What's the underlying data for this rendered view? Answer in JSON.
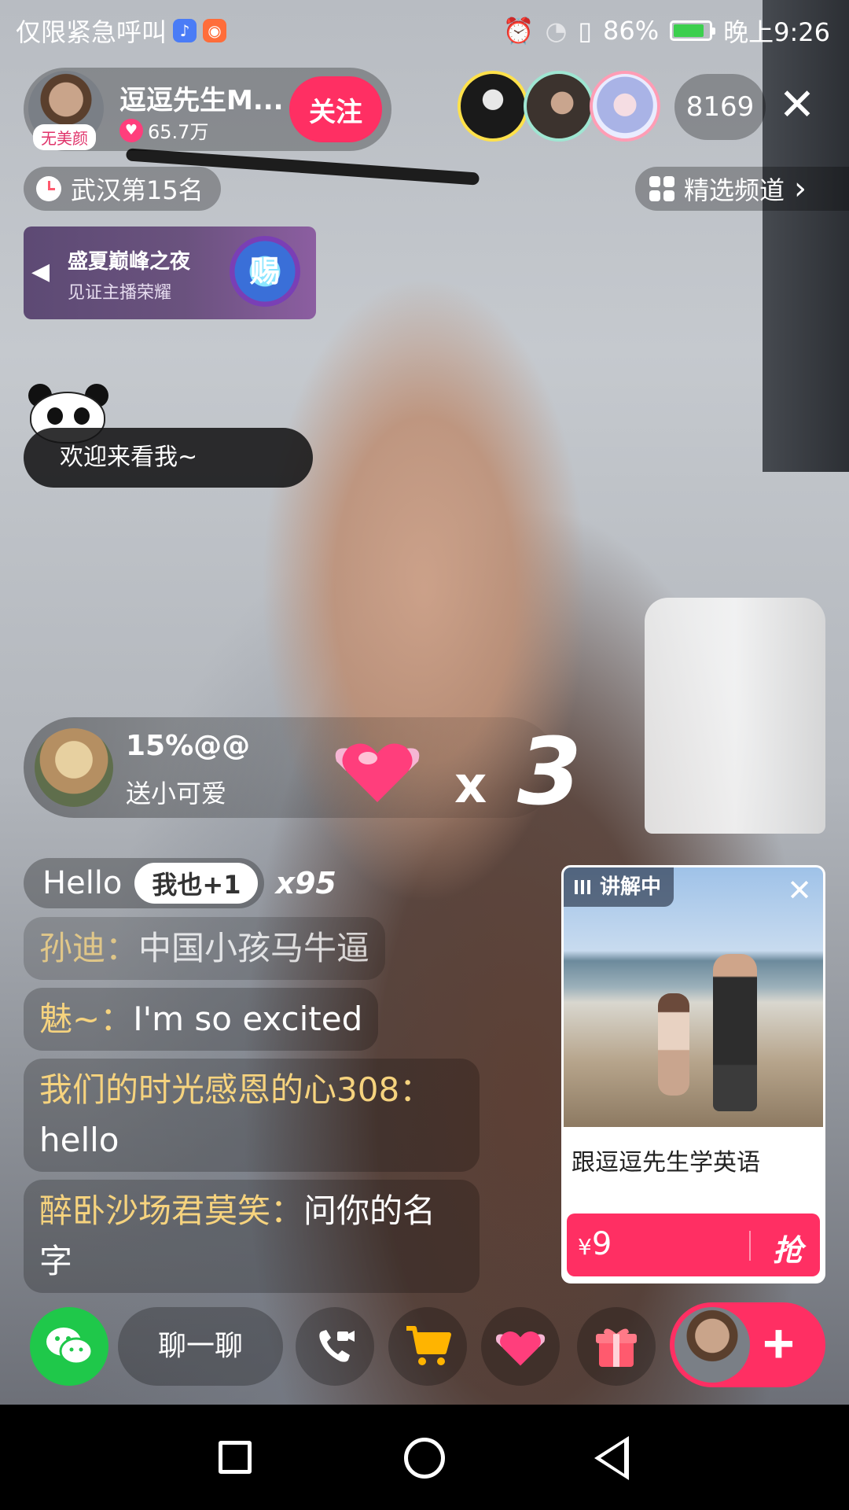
{
  "status_bar": {
    "carrier_text": "仅限紧急呼叫",
    "battery_percent": "86%",
    "battery_level": 0.86,
    "time": "晚上9:26",
    "accent_battery": "#3ccf4e"
  },
  "host": {
    "name": "逗逗先生M...",
    "tag": "无美颜",
    "likes": "65.7万",
    "follow_label": "关注"
  },
  "viewers": {
    "count": "8169"
  },
  "rank": {
    "label": "武汉第15名"
  },
  "channel": {
    "label": "精选频道",
    "chevron": "›"
  },
  "banner": {
    "title": "盛夏巅峰之夜",
    "subtitle": "见证主播荣耀",
    "badge": "赐"
  },
  "welcome": {
    "text": "欢迎来看我~"
  },
  "gift_combo": {
    "sender": "15%@@",
    "action": "送小可爱",
    "x_label": "x",
    "count": "3"
  },
  "chat": {
    "hello_text": "Hello",
    "plus_one_label": "我也+1",
    "multiplier": "x95",
    "messages": [
      {
        "user": "孙迪：",
        "text": "中国小孩马牛逼"
      },
      {
        "user": "魅~：",
        "text": "I'm so excited"
      },
      {
        "user": "我们的时光感恩的心308：",
        "text": "hello"
      },
      {
        "user": "醉卧沙场君莫笑：",
        "text": "问你的名字"
      }
    ]
  },
  "product": {
    "badge": "讲解中",
    "title": "跟逗逗先生学英语",
    "currency": "¥",
    "price": "9",
    "buy_label": "抢"
  },
  "toolbar": {
    "chat_placeholder": "聊一聊",
    "brand_color": "#ff2f63"
  }
}
